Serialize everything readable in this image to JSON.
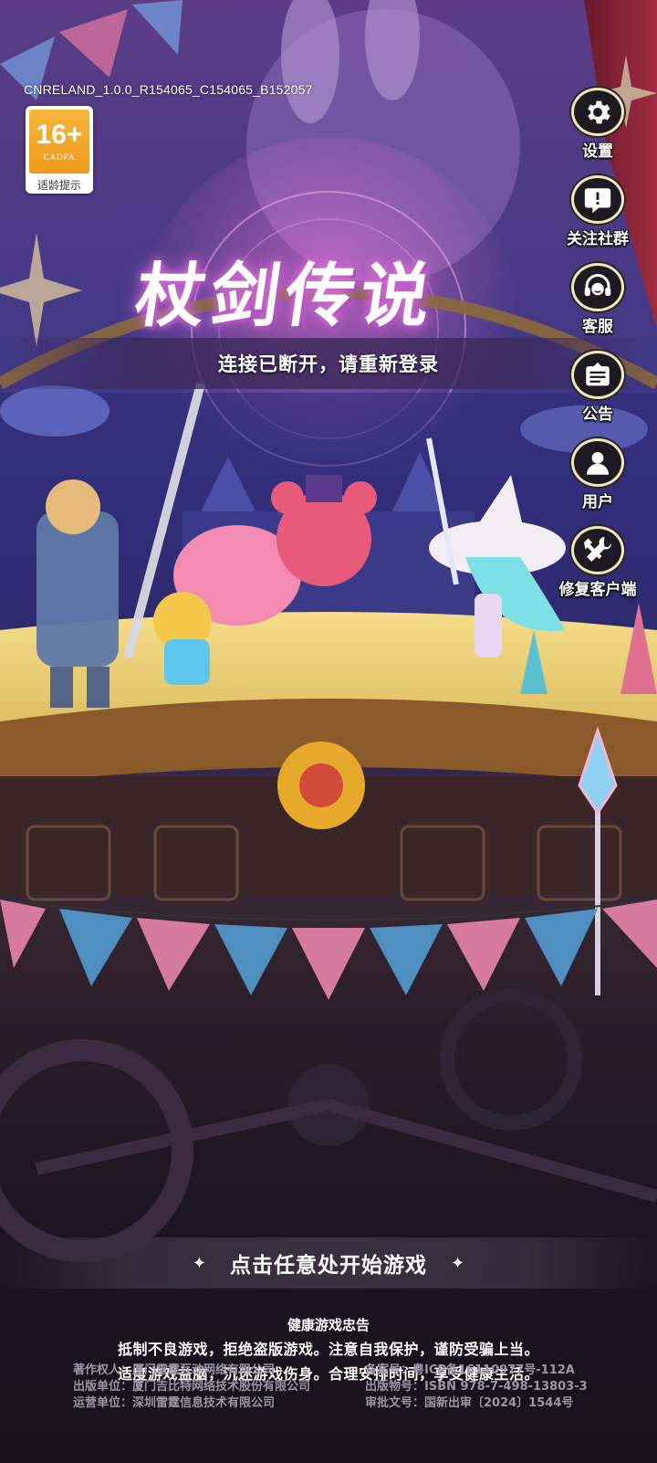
{
  "app": {
    "version_string": "CNRELAND_1.0.0_R154065_C154065_B152057",
    "title": "杖剑传说"
  },
  "age_rating": {
    "value": "16+",
    "org": "CADPA",
    "label": "适龄提示"
  },
  "side_menu": {
    "items": [
      {
        "label": "设置",
        "icon": "gear-icon"
      },
      {
        "label": "关注社群",
        "icon": "speech-bubble-icon"
      },
      {
        "label": "客服",
        "icon": "headset-icon"
      },
      {
        "label": "公告",
        "icon": "notice-board-icon"
      },
      {
        "label": "用户",
        "icon": "user-icon"
      },
      {
        "label": "修复客户端",
        "icon": "wrench-hammer-icon"
      }
    ]
  },
  "status_message": "连接已断开，请重新登录",
  "start_prompt": "点击任意处开始游戏",
  "health_advice": {
    "heading": "健康游戏忠告",
    "line1": "抵制不良游戏，拒绝盗版游戏。注意自我保护，谨防受骗上当。",
    "line2": "适度游戏益脑，沉迷游戏伤身。合理安排时间，享受健康生活。"
  },
  "credits": {
    "rows": [
      {
        "left": "著作权人：厦门雷霆互动网络有限公司",
        "right": "备案号：粤ICP备16110977号-112A"
      },
      {
        "left": "出版单位：厦门吉比特网络技术股份有限公司",
        "right": "出版物号：ISBN 978-7-498-13803-3"
      },
      {
        "left": "运营单位：深圳雷霆信息技术有限公司",
        "right": "审批文号：国新出审〔2024〕1544号"
      }
    ]
  },
  "colors": {
    "badge_orange": "#f09a1b",
    "menu_ring": "#f2e9b5",
    "logo_glow": "#e07ad8"
  }
}
